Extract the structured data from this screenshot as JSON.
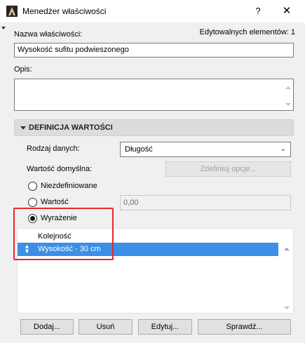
{
  "window": {
    "title": "Menedżer właściwości",
    "help_label": "?",
    "close_label": "✕"
  },
  "property": {
    "name_label": "Nazwa właściwości:",
    "editable_count_label": "Edytowalnych elementów: 1",
    "name_value": "Wysokość sufitu podwieszonego",
    "description_label": "Opis:",
    "description_value": ""
  },
  "definition": {
    "section_title": "DEFINICJA WARTOŚCI",
    "data_type_label": "Rodzaj danych:",
    "data_type_value": "Długość",
    "default_value_label": "Wartość domyślna:",
    "define_options_label": "Zdefiniuj opcje...",
    "options": [
      {
        "label": "Niezdefiniowane",
        "checked": false
      },
      {
        "label": "Wartość",
        "checked": false
      },
      {
        "label": "Wyrażenie",
        "checked": true
      }
    ],
    "value_field": "0,00"
  },
  "expression_list": {
    "header": "Kolejność",
    "rows": [
      {
        "label": "Wysokość - 30 cm",
        "selected": true
      }
    ]
  },
  "buttons": {
    "add": "Dodaj...",
    "remove": "Usuń",
    "edit": "Edytuj...",
    "check": "Sprawdź..."
  },
  "colors": {
    "highlight": "#e8262b",
    "selection": "#3b8fe6"
  }
}
